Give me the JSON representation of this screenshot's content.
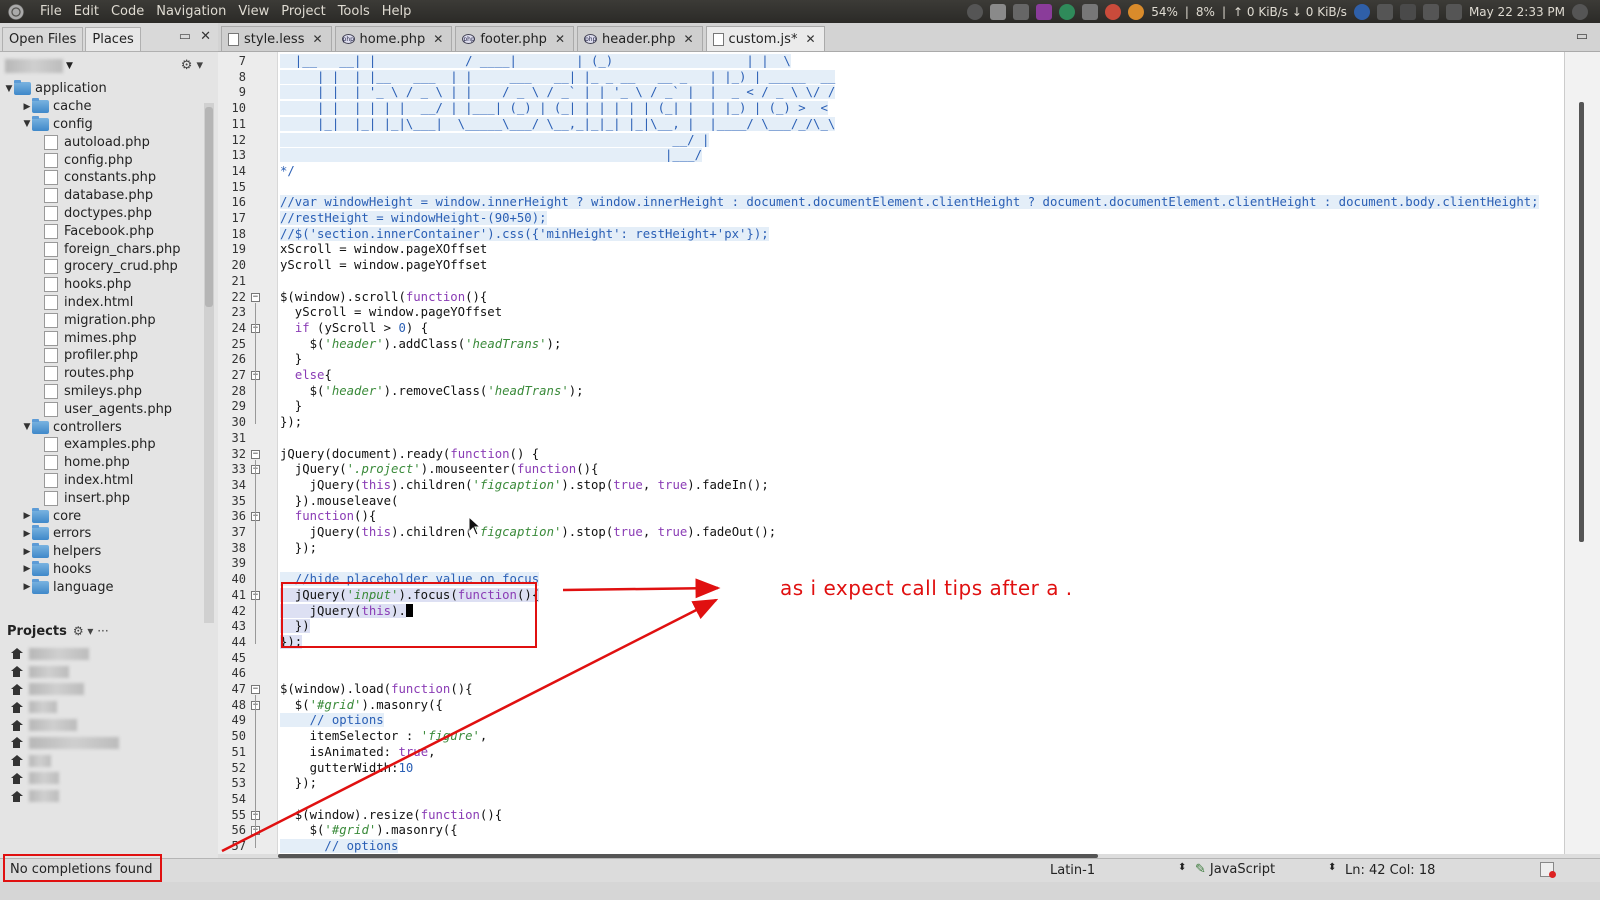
{
  "topbar": {
    "menu": [
      "File",
      "Edit",
      "Code",
      "Navigation",
      "View",
      "Project",
      "Tools",
      "Help"
    ],
    "battery": "54%",
    "cpu": "8%",
    "network": "↑ 0 KiB/s ↓ 0 KiB/s",
    "datetime": "May 22  2:33 PM"
  },
  "sidebar": {
    "tabs": [
      "Open Files",
      "Places"
    ],
    "tree": [
      {
        "label": "application",
        "type": "folder",
        "depth": 0,
        "expanded": true
      },
      {
        "label": "cache",
        "type": "folder",
        "depth": 1,
        "expanded": false
      },
      {
        "label": "config",
        "type": "folder",
        "depth": 1,
        "expanded": true
      },
      {
        "label": "autoload.php",
        "type": "file",
        "depth": 2
      },
      {
        "label": "config.php",
        "type": "file",
        "depth": 2
      },
      {
        "label": "constants.php",
        "type": "file",
        "depth": 2
      },
      {
        "label": "database.php",
        "type": "file",
        "depth": 2
      },
      {
        "label": "doctypes.php",
        "type": "file",
        "depth": 2
      },
      {
        "label": "Facebook.php",
        "type": "file",
        "depth": 2
      },
      {
        "label": "foreign_chars.php",
        "type": "file",
        "depth": 2
      },
      {
        "label": "grocery_crud.php",
        "type": "file",
        "depth": 2
      },
      {
        "label": "hooks.php",
        "type": "file",
        "depth": 2
      },
      {
        "label": "index.html",
        "type": "file",
        "depth": 2
      },
      {
        "label": "migration.php",
        "type": "file",
        "depth": 2
      },
      {
        "label": "mimes.php",
        "type": "file",
        "depth": 2
      },
      {
        "label": "profiler.php",
        "type": "file",
        "depth": 2
      },
      {
        "label": "routes.php",
        "type": "file",
        "depth": 2
      },
      {
        "label": "smileys.php",
        "type": "file",
        "depth": 2
      },
      {
        "label": "user_agents.php",
        "type": "file",
        "depth": 2
      },
      {
        "label": "controllers",
        "type": "folder",
        "depth": 1,
        "expanded": true
      },
      {
        "label": "examples.php",
        "type": "file",
        "depth": 2
      },
      {
        "label": "home.php",
        "type": "file",
        "depth": 2
      },
      {
        "label": "index.html",
        "type": "file",
        "depth": 2
      },
      {
        "label": "insert.php",
        "type": "file",
        "depth": 2
      },
      {
        "label": "core",
        "type": "folder",
        "depth": 1,
        "expanded": false
      },
      {
        "label": "errors",
        "type": "folder",
        "depth": 1,
        "expanded": false
      },
      {
        "label": "helpers",
        "type": "folder",
        "depth": 1,
        "expanded": false
      },
      {
        "label": "hooks",
        "type": "folder",
        "depth": 1,
        "expanded": false
      },
      {
        "label": "language",
        "type": "folder",
        "depth": 1,
        "expanded": false
      }
    ],
    "projects_label": "Projects",
    "project_count": 9
  },
  "tabs": [
    {
      "label": "style.less",
      "icon": "doc",
      "active": false
    },
    {
      "label": "home.php",
      "icon": "php",
      "active": false
    },
    {
      "label": "footer.php",
      "icon": "php",
      "active": false
    },
    {
      "label": "header.php",
      "icon": "php",
      "active": false
    },
    {
      "label": "custom.js*",
      "icon": "doc",
      "active": true
    }
  ],
  "editor": {
    "lines": [
      {
        "n": 7,
        "t": "  |__   __| |            / ____|        | (_)                  | |  \\",
        "c": "cmt",
        "hl": true
      },
      {
        "n": 8,
        "t": "     | |  | |__   ___  | |     ___   __| |_ _ __   __ _   | |_) | _____  __",
        "c": "cmt",
        "hl": true
      },
      {
        "n": 9,
        "t": "     | |  | '_ \\ / _ \\ | |    / _ \\ / _` | | '_ \\ / _` |  |  _ < / _ \\ \\/ /",
        "c": "cmt",
        "hl": true
      },
      {
        "n": 10,
        "t": "     | |  | | | |  __/ | |___| (_) | (_| | | | | | (_| |  | |_) | (_) >  <",
        "c": "cmt",
        "hl": true
      },
      {
        "n": 11,
        "t": "     |_|  |_| |_|\\___|  \\_____\\___/ \\__,_|_|_| |_|\\__, |  |____/ \\___/_/\\_\\",
        "c": "cmt",
        "hl": true
      },
      {
        "n": 12,
        "t": "                                                     __/ |",
        "c": "cmt",
        "hl": true
      },
      {
        "n": 13,
        "t": "                                                    |___/",
        "c": "cmt",
        "hl": true
      },
      {
        "n": 14,
        "t": "*/",
        "c": "cmt",
        "hl": false
      },
      {
        "n": 15,
        "t": "",
        "c": "pl",
        "hl": false
      },
      {
        "n": 16,
        "t": "//var windowHeight = window.innerHeight ? window.innerHeight : document.documentElement.clientHeight ? document.documentElement.clientHeight : document.body.clientHeight;",
        "c": "cmt",
        "hl": true
      },
      {
        "n": 17,
        "t": "//restHeight = windowHeight-(90+50);",
        "c": "cmt",
        "hl": true
      },
      {
        "n": 18,
        "t": "//$('section.innerContainer').css({'minHeight': restHeight+'px'});",
        "c": "cmt",
        "hl": true
      },
      {
        "n": 19,
        "t": "xScroll = window.pageXOffset",
        "c": "pl",
        "hl": false
      },
      {
        "n": 20,
        "t": "yScroll = window.pageYOffset",
        "c": "pl",
        "hl": false
      },
      {
        "n": 21,
        "t": "",
        "c": "pl",
        "hl": false
      },
      {
        "n": 22,
        "t": "$(window).scroll(function(){",
        "c": "mix",
        "hl": false
      },
      {
        "n": 23,
        "t": "  yScroll = window.pageYOffset",
        "c": "pl",
        "hl": false
      },
      {
        "n": 24,
        "t": "  if (yScroll > 0) {",
        "c": "mix",
        "hl": false
      },
      {
        "n": 25,
        "t": "    $('header').addClass('headTrans');",
        "c": "mix",
        "hl": false
      },
      {
        "n": 26,
        "t": "  }",
        "c": "pl",
        "hl": false
      },
      {
        "n": 27,
        "t": "  else{",
        "c": "mix",
        "hl": false
      },
      {
        "n": 28,
        "t": "    $('header').removeClass('headTrans');",
        "c": "mix",
        "hl": false
      },
      {
        "n": 29,
        "t": "  }",
        "c": "pl",
        "hl": false
      },
      {
        "n": 30,
        "t": "});",
        "c": "pl",
        "hl": false
      },
      {
        "n": 31,
        "t": "",
        "c": "pl",
        "hl": false
      },
      {
        "n": 32,
        "t": "jQuery(document).ready(function() {",
        "c": "mix",
        "hl": false
      },
      {
        "n": 33,
        "t": "  jQuery('.project').mouseenter(function(){",
        "c": "mix",
        "hl": false
      },
      {
        "n": 34,
        "t": "    jQuery(this).children('figcaption').stop(true, true).fadeIn();",
        "c": "mix",
        "hl": false
      },
      {
        "n": 35,
        "t": "  }).mouseleave(",
        "c": "pl",
        "hl": false
      },
      {
        "n": 36,
        "t": "  function(){",
        "c": "mix",
        "hl": false
      },
      {
        "n": 37,
        "t": "    jQuery(this).children('figcaption').stop(true, true).fadeOut();",
        "c": "mix",
        "hl": false
      },
      {
        "n": 38,
        "t": "  });",
        "c": "pl",
        "hl": false
      },
      {
        "n": 39,
        "t": "",
        "c": "pl",
        "hl": false
      },
      {
        "n": 40,
        "t": "  //hide placeholder value on focus",
        "c": "cmt",
        "hl": true
      },
      {
        "n": 41,
        "t": "  jQuery('input').focus(function(){",
        "c": "mix",
        "hl": false
      },
      {
        "n": 42,
        "t": "    jQuery(this).",
        "c": "mix",
        "hl": false
      },
      {
        "n": 43,
        "t": "  })",
        "c": "pl",
        "hl": false
      },
      {
        "n": 44,
        "t": "});",
        "c": "pl",
        "hl": false
      },
      {
        "n": 45,
        "t": "",
        "c": "pl",
        "hl": false
      },
      {
        "n": 46,
        "t": "",
        "c": "pl",
        "hl": false
      },
      {
        "n": 47,
        "t": "$(window).load(function(){",
        "c": "mix",
        "hl": false
      },
      {
        "n": 48,
        "t": "  $('#grid').masonry({",
        "c": "mix",
        "hl": false
      },
      {
        "n": 49,
        "t": "    // options",
        "c": "cmt",
        "hl": true
      },
      {
        "n": 50,
        "t": "    itemSelector : 'figure',",
        "c": "mix",
        "hl": false
      },
      {
        "n": 51,
        "t": "    isAnimated: true,",
        "c": "mix",
        "hl": false
      },
      {
        "n": 52,
        "t": "    gutterWidth:10",
        "c": "mix",
        "hl": false
      },
      {
        "n": 53,
        "t": "  });",
        "c": "pl",
        "hl": false
      },
      {
        "n": 54,
        "t": "",
        "c": "pl",
        "hl": false
      },
      {
        "n": 55,
        "t": "  $(window).resize(function(){",
        "c": "mix",
        "hl": false
      },
      {
        "n": 56,
        "t": "    $('#grid').masonry({",
        "c": "mix",
        "hl": false
      },
      {
        "n": 57,
        "t": "      // options",
        "c": "cmt",
        "hl": true
      }
    ],
    "fold_lines": [
      22,
      24,
      27,
      32,
      33,
      36,
      41,
      47,
      48,
      55,
      56
    ]
  },
  "statusbar": {
    "message": "No completions found",
    "encoding": "Latin-1",
    "language": "JavaScript",
    "position": "Ln: 42 Col: 18"
  },
  "annotation": {
    "text": "as i expect call tips after a ."
  },
  "colors": {
    "annotation": "#e01010",
    "comment": "#2a5fb5",
    "string": "#3a8a3a",
    "keyword": "#8a3cb5"
  }
}
